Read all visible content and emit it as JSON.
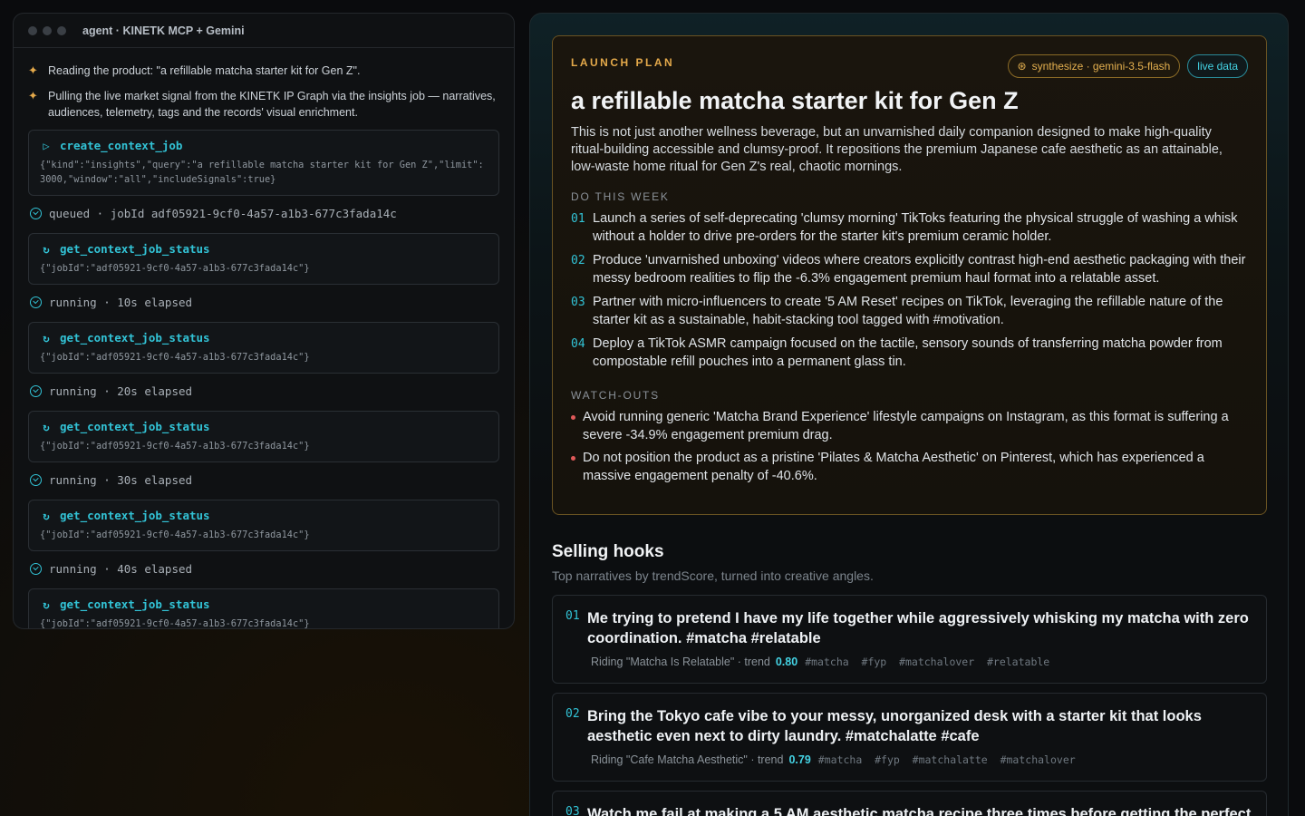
{
  "agent": {
    "title": "agent · KINETK MCP + Gemini",
    "log": [
      "Reading the product: \"a refillable matcha starter kit for Gen Z\".",
      "Pulling the live market signal from the KINETK IP Graph via the insights job — narratives, audiences, telemetry, tags and the records' visual enrichment."
    ],
    "steps": [
      {
        "tool": "create_context_job",
        "icon": "play-icon",
        "args": "{\"kind\":\"insights\",\"query\":\"a refillable matcha starter kit for Gen Z\",\"limit\":3000,\"window\":\"all\",\"includeSignals\":true}",
        "status": "queued · jobId adf05921-9cf0-4a57-a1b3-677c3fada14c"
      },
      {
        "tool": "get_context_job_status",
        "icon": "refresh-icon",
        "args": "{\"jobId\":\"adf05921-9cf0-4a57-a1b3-677c3fada14c\"}",
        "status": "running · 10s elapsed"
      },
      {
        "tool": "get_context_job_status",
        "icon": "refresh-icon",
        "args": "{\"jobId\":\"adf05921-9cf0-4a57-a1b3-677c3fada14c\"}",
        "status": "running · 20s elapsed"
      },
      {
        "tool": "get_context_job_status",
        "icon": "refresh-icon",
        "args": "{\"jobId\":\"adf05921-9cf0-4a57-a1b3-677c3fada14c\"}",
        "status": "running · 30s elapsed"
      },
      {
        "tool": "get_context_job_status",
        "icon": "refresh-icon",
        "args": "{\"jobId\":\"adf05921-9cf0-4a57-a1b3-677c3fada14c\"}",
        "status": "running · 40s elapsed"
      },
      {
        "tool": "get_context_job_status",
        "icon": "refresh-icon",
        "args": "{\"jobId\":\"adf05921-9cf0-4a57-a1b3-677c3fada14c\"}",
        "status": ""
      }
    ]
  },
  "plan": {
    "eyebrow": "LAUNCH PLAN",
    "badge_synth": "synthesize · gemini-3.5-flash",
    "badge_live": "live data",
    "title": "a refillable matcha starter kit for Gen Z",
    "description": "This is not just another wellness beverage, but an unvarnished daily companion designed to make high-quality ritual-building accessible and clumsy-proof. It repositions the premium Japanese cafe aesthetic as an attainable, low-waste home ritual for Gen Z's real, chaotic mornings.",
    "do_label": "DO THIS WEEK",
    "do_items": [
      {
        "num": "01",
        "text": "Launch a series of self-deprecating 'clumsy morning' TikToks featuring the physical struggle of washing a whisk without a holder to drive pre-orders for the starter kit's premium ceramic holder."
      },
      {
        "num": "02",
        "text": "Produce 'unvarnished unboxing' videos where creators explicitly contrast high-end aesthetic packaging with their messy bedroom realities to flip the -6.3% engagement premium haul format into a relatable asset."
      },
      {
        "num": "03",
        "text": "Partner with micro-influencers to create '5 AM Reset' recipes on TikTok, leveraging the refillable nature of the starter kit as a sustainable, habit-stacking tool tagged with #motivation."
      },
      {
        "num": "04",
        "text": "Deploy a TikTok ASMR campaign focused on the tactile, sensory sounds of transferring matcha powder from compostable refill pouches into a permanent glass tin."
      }
    ],
    "watch_label": "WATCH-OUTS",
    "watch_items": [
      "Avoid running generic 'Matcha Brand Experience' lifestyle campaigns on Instagram, as this format is suffering a severe -34.9% engagement premium drag.",
      "Do not position the product as a pristine 'Pilates & Matcha Aesthetic' on Pinterest, which has experienced a massive engagement penalty of -40.6%."
    ]
  },
  "hooks": {
    "title": "Selling hooks",
    "subtitle": "Top narratives by trendScore, turned into creative angles.",
    "items": [
      {
        "num": "01",
        "text": "Me trying to pretend I have my life together while aggressively whisking my matcha with zero coordination. #matcha #relatable",
        "riding": "Riding \"Matcha Is Relatable\" · trend",
        "trend": "0.80",
        "tags": "#matcha  #fyp  #matchalover  #relatable"
      },
      {
        "num": "02",
        "text": "Bring the Tokyo cafe vibe to your messy, unorganized desk with a starter kit that looks aesthetic even next to dirty laundry. #matchalatte #cafe",
        "riding": "Riding \"Cafe Matcha Aesthetic\" · trend",
        "trend": "0.79",
        "tags": "#matcha  #fyp  #matchalatte  #matchalover"
      },
      {
        "num": "03",
        "text": "Watch me fail at making a 5 AM aesthetic matcha recipe three times before getting the perfect",
        "riding": "",
        "trend": "",
        "tags": ""
      }
    ]
  }
}
